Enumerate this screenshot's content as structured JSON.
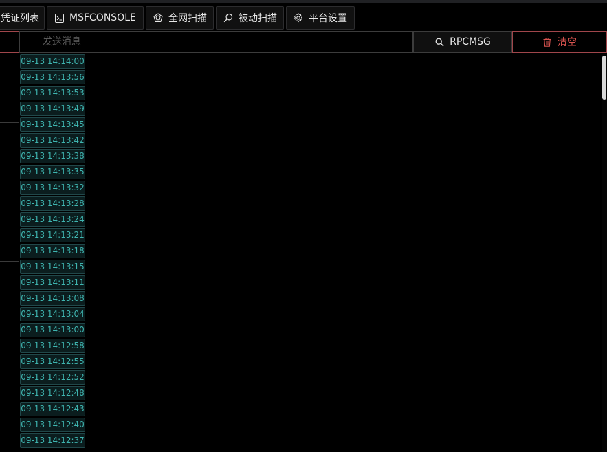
{
  "tabs": [
    {
      "label": "凭证列表",
      "icon": "list-icon"
    },
    {
      "label": "MSFCONSOLE",
      "icon": "terminal-icon"
    },
    {
      "label": "全网扫描",
      "icon": "globe-scan-icon"
    },
    {
      "label": "被动扫描",
      "icon": "magnifier-icon"
    },
    {
      "label": "平台设置",
      "icon": "gear-icon"
    }
  ],
  "toolbar": {
    "message_placeholder": "发送消息",
    "message_value": "",
    "rpcmsg_label": "RPCMSG",
    "clear_label": "清空"
  },
  "log": {
    "timestamps": [
      "09-13 14:14:00",
      "09-13 14:13:56",
      "09-13 14:13:53",
      "09-13 14:13:49",
      "09-13 14:13:45",
      "09-13 14:13:42",
      "09-13 14:13:38",
      "09-13 14:13:35",
      "09-13 14:13:32",
      "09-13 14:13:28",
      "09-13 14:13:24",
      "09-13 14:13:21",
      "09-13 14:13:18",
      "09-13 14:13:15",
      "09-13 14:13:11",
      "09-13 14:13:08",
      "09-13 14:13:04",
      "09-13 14:13:00",
      "09-13 14:12:58",
      "09-13 14:12:55",
      "09-13 14:12:52",
      "09-13 14:12:48",
      "09-13 14:12:43",
      "09-13 14:12:40",
      "09-13 14:12:37"
    ]
  },
  "colors": {
    "accent_red": "#d9534f",
    "timestamp_teal": "#3fb5b0",
    "background": "#000000"
  }
}
